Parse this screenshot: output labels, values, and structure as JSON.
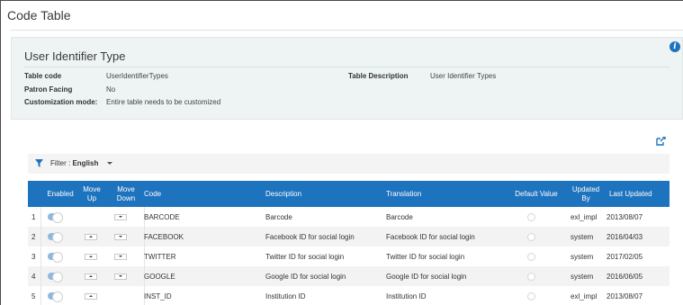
{
  "page": {
    "title": "Code Table"
  },
  "details": {
    "section_title": "User Identifier Type",
    "table_code_label": "Table code",
    "table_code_value": "UserIdentifierTypes",
    "table_description_label": "Table Description",
    "table_description_value": "User Identifier Types",
    "patron_facing_label": "Patron Facing",
    "patron_facing_value": "No",
    "customization_label": "Customization mode:",
    "customization_value": "Entire table needs to be customized"
  },
  "filter": {
    "label": "Filter : ",
    "value": "English"
  },
  "table": {
    "headers": {
      "enabled": "Enabled",
      "move_up_1": "Move",
      "move_up_2": "Up",
      "move_down_1": "Move",
      "move_down_2": "Down",
      "code": "Code",
      "description": "Description",
      "translation": "Translation",
      "default_value": "Default Value",
      "updated_by_1": "Updated",
      "updated_by_2": "By",
      "last_updated": "Last Updated"
    },
    "rows": [
      {
        "num": "1",
        "code": "BARCODE",
        "description": "Barcode",
        "translation": "Barcode",
        "updated_by": "exl_impl",
        "last_updated": "2013/08/07"
      },
      {
        "num": "2",
        "code": "FACEBOOK",
        "description": "Facebook ID for social login",
        "translation": "Facebook ID for social login",
        "updated_by": "system",
        "last_updated": "2016/04/03"
      },
      {
        "num": "3",
        "code": "TWITTER",
        "description": "Twitter ID for social login",
        "translation": "Twitter ID for social login",
        "updated_by": "system",
        "last_updated": "2017/02/05"
      },
      {
        "num": "4",
        "code": "GOOGLE",
        "description": "Google ID for social login",
        "translation": "Google ID for social login",
        "updated_by": "system",
        "last_updated": "2016/06/05"
      },
      {
        "num": "5",
        "code": "INST_ID",
        "description": "Institution ID",
        "translation": "Institution ID",
        "updated_by": "exl_impl",
        "last_updated": "2013/08/07"
      }
    ]
  },
  "colors": {
    "header_blue": "#1e73be",
    "toggle_on": "#8fb8df",
    "panel_bg": "#eef3f3"
  }
}
